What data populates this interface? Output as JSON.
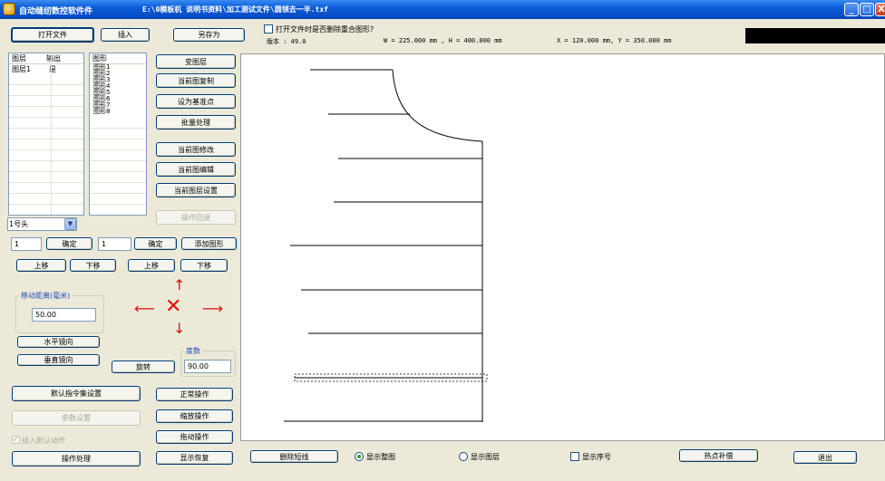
{
  "window": {
    "app_title": "自动缝纫数控软件件",
    "file_path": "E:\\0模板机 说明书资料\\加工测试文件\\圆领去一半.txf",
    "min_label": "_",
    "max_label": "□",
    "close_label": "X"
  },
  "toolbar": {
    "open_file": "打开文件",
    "insert": "插入",
    "save_as": "另存为",
    "delete_overlap_checkbox": "打开文件时是否删除重合图形?",
    "version": "版本 :  49.0",
    "size_readout": "W = 225.000 mm , H = 400.000 mm",
    "coord_readout": "X = 120.000 mm, Y = 350.000 mm"
  },
  "layer_list": {
    "col_layer": "图层",
    "col_output": "输出",
    "rows": [
      {
        "layer": "图层1",
        "output": "是"
      }
    ]
  },
  "shape_list": {
    "col_shape": "图形",
    "items": [
      "图形1",
      "图形2",
      "图形3",
      "图形4",
      "图形5",
      "图形6",
      "图形7",
      "图形8"
    ]
  },
  "right_buttons": {
    "change_layer": "变图层",
    "copy_current": "当前图复制",
    "set_base": "设为基准点",
    "batch": "批量处理",
    "modify_current": "当前图修改",
    "edit_current": "当前图编辑",
    "layer_settings": "当前图层设置",
    "undo": "操作回退"
  },
  "head_select": {
    "value": "1号头"
  },
  "controls": {
    "input1": "1",
    "confirm1": "确定",
    "input2": "1",
    "confirm2": "确定",
    "add_shape": "添加图形",
    "move_up1": "上移",
    "move_down1": "下移",
    "move_up2": "上移",
    "move_down2": "下移",
    "move_distance_label": "移动距离(毫米)",
    "move_distance": "50.00",
    "arrow_up": "↑",
    "arrow_down": "↓",
    "arrow_left": "⟵",
    "arrow_right": "⟶",
    "center_x": "✕",
    "mirror_h": "水平镜向",
    "mirror_v": "垂直镜向",
    "rotate": "旋转",
    "degree_label": "度数",
    "degree_value": "90.00"
  },
  "bottom_left": {
    "default_cmd": "默认指令集设置",
    "param_settings": "参数设置",
    "insert_default": "插入默认动作",
    "process": "操作处理",
    "normal_op": "正常操作",
    "zoom_op": "缩放操作",
    "drag_op": "拖动操作",
    "restore_view": "显示恢复"
  },
  "bottom_bar": {
    "delete_short": "删除短线",
    "show_all": "显示整图",
    "show_layer": "显示图层",
    "show_seq": "显示序号",
    "hot_comp": "热点补偿",
    "exit": "退出"
  },
  "colors": {
    "window_bg": "#ece9d8",
    "titlebar": "#0a5bd8",
    "arrow_red": "#e01010",
    "shape_line": "#000000",
    "selection_dash": "#000000"
  }
}
